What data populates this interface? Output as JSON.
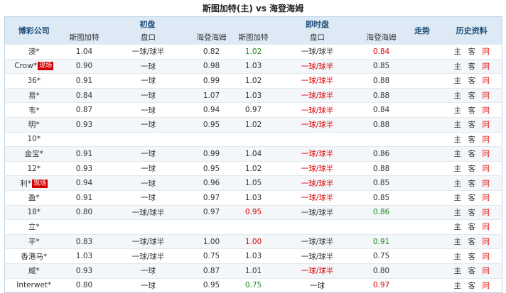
{
  "title": "斯图加特(主) vs 海登海姆",
  "headers": {
    "company": "博彩公司",
    "initial": "初盘",
    "live": "即时盘",
    "trend": "走势",
    "history": "历史资料",
    "home": "斯图加特",
    "line": "盘口",
    "away": "海登海姆"
  },
  "history_links": {
    "home": "主",
    "away": "客",
    "same": "同"
  },
  "colors": {
    "header_bg": "#dde9f5",
    "up": "#e00000",
    "down": "#1b8c1b",
    "badge": "#d40000"
  },
  "rows": [
    {
      "name": "澳*",
      "badge": "",
      "ih": "1.04",
      "il": "一球/球半",
      "ia": "0.82",
      "lh": "1.02",
      "lh_c": "green",
      "ll": "一球/球半",
      "ll_c": "",
      "la": "0.84",
      "la_c": "red"
    },
    {
      "name": "Crow*",
      "badge": "现场",
      "ih": "0.90",
      "il": "一球",
      "ia": "0.98",
      "lh": "1.03",
      "lh_c": "",
      "ll": "一球/球半",
      "ll_c": "red",
      "la": "0.85",
      "la_c": ""
    },
    {
      "name": "36*",
      "badge": "",
      "ih": "0.91",
      "il": "一球",
      "ia": "0.99",
      "lh": "1.02",
      "lh_c": "",
      "ll": "一球/球半",
      "ll_c": "red",
      "la": "0.88",
      "la_c": ""
    },
    {
      "name": "易*",
      "badge": "",
      "ih": "0.84",
      "il": "一球",
      "ia": "1.07",
      "lh": "1.03",
      "lh_c": "",
      "ll": "一球/球半",
      "ll_c": "red",
      "la": "0.88",
      "la_c": ""
    },
    {
      "name": "韦*",
      "badge": "",
      "ih": "0.87",
      "il": "一球",
      "ia": "0.94",
      "lh": "0.97",
      "lh_c": "",
      "ll": "一球/球半",
      "ll_c": "red",
      "la": "0.84",
      "la_c": ""
    },
    {
      "name": "明*",
      "badge": "",
      "ih": "0.93",
      "il": "一球",
      "ia": "0.95",
      "lh": "1.02",
      "lh_c": "",
      "ll": "一球/球半",
      "ll_c": "red",
      "la": "0.88",
      "la_c": ""
    },
    {
      "name": "10*",
      "badge": "",
      "ih": "",
      "il": "",
      "ia": "",
      "lh": "",
      "lh_c": "",
      "ll": "",
      "ll_c": "",
      "la": "",
      "la_c": ""
    },
    {
      "name": "金宝*",
      "badge": "",
      "ih": "0.91",
      "il": "一球",
      "ia": "0.99",
      "lh": "1.04",
      "lh_c": "",
      "ll": "一球/球半",
      "ll_c": "red",
      "la": "0.86",
      "la_c": ""
    },
    {
      "name": "12*",
      "badge": "",
      "ih": "0.93",
      "il": "一球",
      "ia": "0.95",
      "lh": "1.02",
      "lh_c": "",
      "ll": "一球/球半",
      "ll_c": "red",
      "la": "0.88",
      "la_c": ""
    },
    {
      "name": "利*",
      "badge": "现场",
      "ih": "0.94",
      "il": "一球",
      "ia": "0.96",
      "lh": "1.05",
      "lh_c": "",
      "ll": "一球/球半",
      "ll_c": "red",
      "la": "0.85",
      "la_c": ""
    },
    {
      "name": "盈*",
      "badge": "",
      "ih": "0.91",
      "il": "一球",
      "ia": "0.97",
      "lh": "1.03",
      "lh_c": "",
      "ll": "一球/球半",
      "ll_c": "red",
      "la": "0.85",
      "la_c": ""
    },
    {
      "name": "18*",
      "badge": "",
      "ih": "0.80",
      "il": "一球/球半",
      "ia": "0.97",
      "lh": "0.95",
      "lh_c": "red",
      "ll": "一球/球半",
      "ll_c": "",
      "la": "0.86",
      "la_c": "green"
    },
    {
      "name": "立*",
      "badge": "",
      "ih": "",
      "il": "",
      "ia": "",
      "lh": "",
      "lh_c": "",
      "ll": "",
      "ll_c": "",
      "la": "",
      "la_c": ""
    },
    {
      "name": "平*",
      "badge": "",
      "ih": "0.83",
      "il": "一球/球半",
      "ia": "1.00",
      "lh": "1.00",
      "lh_c": "red",
      "ll": "一球/球半",
      "ll_c": "",
      "la": "0.91",
      "la_c": "green"
    },
    {
      "name": "香港马*",
      "badge": "",
      "ih": "1.03",
      "il": "一球/球半",
      "ia": "0.75",
      "lh": "1.03",
      "lh_c": "",
      "ll": "一球/球半",
      "ll_c": "",
      "la": "0.75",
      "la_c": ""
    },
    {
      "name": "威*",
      "badge": "",
      "ih": "0.93",
      "il": "一球",
      "ia": "0.87",
      "lh": "1.01",
      "lh_c": "",
      "ll": "一球/球半",
      "ll_c": "red",
      "la": "0.80",
      "la_c": ""
    },
    {
      "name": "Interwet*",
      "badge": "",
      "ih": "0.80",
      "il": "一球",
      "ia": "0.95",
      "lh": "0.75",
      "lh_c": "green",
      "ll": "一球",
      "ll_c": "",
      "la": "0.97",
      "la_c": "red"
    }
  ]
}
